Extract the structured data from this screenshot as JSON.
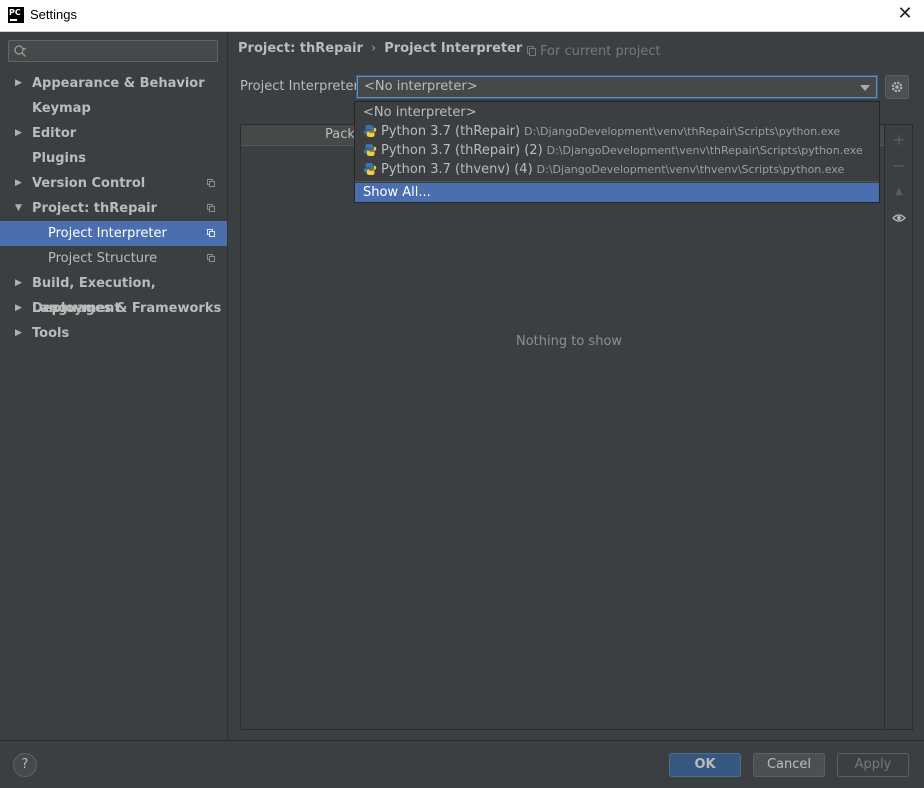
{
  "window": {
    "title": "Settings",
    "app_icon": "pycharm-logo",
    "app_icon_text": "PC"
  },
  "sidebar": {
    "search_placeholder": "",
    "items": [
      {
        "label": "Appearance & Behavior",
        "expandable": true
      },
      {
        "label": "Keymap",
        "expandable": false
      },
      {
        "label": "Editor",
        "expandable": true
      },
      {
        "label": "Plugins",
        "expandable": false
      },
      {
        "label": "Version Control",
        "expandable": true,
        "project_scoped": true
      },
      {
        "label": "Project: thRepair",
        "expandable": true,
        "expanded": true,
        "project_scoped": true
      },
      {
        "label": "Project Interpreter",
        "child": true,
        "selected": true,
        "project_scoped": true
      },
      {
        "label": "Project Structure",
        "child": true,
        "project_scoped": true
      },
      {
        "label": "Build, Execution, Deployment",
        "expandable": true
      },
      {
        "label": "Languages & Frameworks",
        "expandable": true
      },
      {
        "label": "Tools",
        "expandable": true
      }
    ]
  },
  "breadcrumb": {
    "parent": "Project: thRepair",
    "separator": "›",
    "current": "Project Interpreter"
  },
  "scope_note": "For current project",
  "interpreter": {
    "label": "Project Interpreter:",
    "selected_value": "<No interpreter>",
    "options": [
      {
        "name": "<No interpreter>",
        "path": ""
      },
      {
        "name": "Python 3.7 (thRepair)",
        "path": "D:\\DjangoDevelopment\\venv\\thRepair\\Scripts\\python.exe"
      },
      {
        "name": "Python 3.7 (thRepair) (2)",
        "path": "D:\\DjangoDevelopment\\venv\\thRepair\\Scripts\\python.exe"
      },
      {
        "name": "Python 3.7 (thvenv) (4)",
        "path": "D:\\DjangoDevelopment\\venv\\thvenv\\Scripts\\python.exe"
      }
    ],
    "show_all": "Show All..."
  },
  "packages": {
    "column_header_visible": "Packa",
    "empty_text": "Nothing to show"
  },
  "toolbar": {
    "add": "+",
    "remove": "−",
    "upgrade": "▲",
    "show_early": "eye"
  },
  "buttons": {
    "help": "?",
    "ok": "OK",
    "cancel": "Cancel",
    "apply": "Apply"
  },
  "colors": {
    "background": "#3c3f41",
    "selection": "#4b6eaf",
    "focus_border": "#5b8ec7",
    "ok_button": "#365880"
  }
}
